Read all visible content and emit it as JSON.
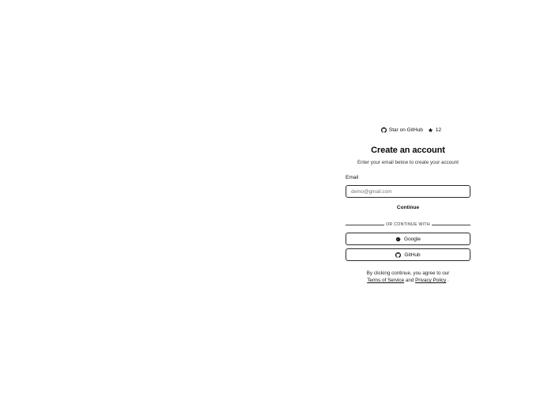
{
  "star_bar": {
    "link_label": "Star on GitHub",
    "star_count": "12",
    "github_icon": "github-icon",
    "star_icon": "star-icon"
  },
  "form": {
    "title": "Create an account",
    "subtitle": "Enter your email below to create your account",
    "email_label": "Email",
    "email_placeholder": "demo@gmail.com",
    "email_value": "",
    "continue_label": "Continue",
    "divider_label": "Or continue with",
    "google_label": "Google",
    "github_label": "GitHub"
  },
  "terms": {
    "prefix": "By clicking continue, you agree to our",
    "terms_link": "Terms of Service",
    "conjunction": "and",
    "privacy_link": "Privacy Policy",
    "suffix": "."
  }
}
